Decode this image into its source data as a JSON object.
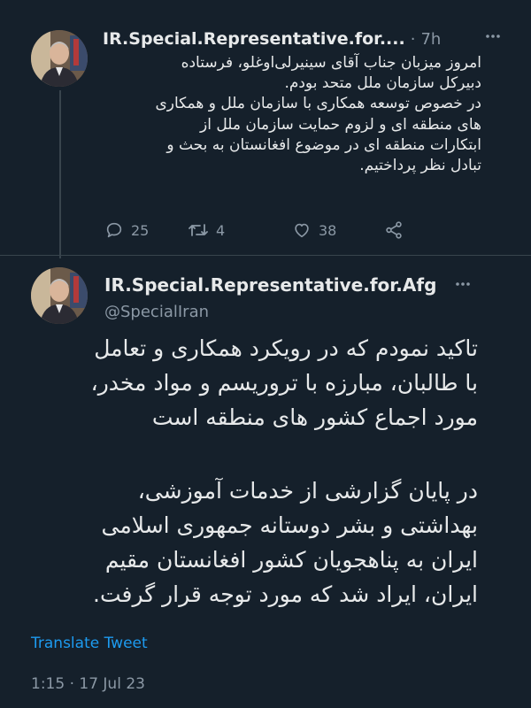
{
  "tweet1": {
    "display_name": "IR.Special.Representative.for....",
    "separator": "·",
    "time": "7h",
    "lines": [
      "امروز میزبان جناب آقای سینیرلی‌اوغلو، فرستاده",
      "دبیرکل سازمان ملل متحد بودم.",
      "در خصوص توسعه همکاری با سازمان ملل و همکاری",
      "های منطقه ای و لزوم حمایت سازمان ملل از",
      "ابتکارات منطقه ای در موضوع افغانستان به بحث و",
      "تبادل نظر پرداختیم."
    ],
    "actions": {
      "reply_count": "25",
      "retweet_count": "4",
      "like_count": "38"
    }
  },
  "tweet2": {
    "display_name": "IR.Special.Representative.for.Afg",
    "handle": "@SpecialIran",
    "paragraph1": [
      "تاکید نمودم که در رویکرد همکاری و تعامل",
      "با طالبان، مبارزه با تروریسم و مواد مخدر،",
      "مورد اجماع کشور های منطقه است"
    ],
    "paragraph2": [
      "در پایان گزارشی از خدمات آموزشی،",
      "بهداشتی و بشر دوستانه جمهوری اسلامی",
      "ایران به پناهجویان کشور افغانستان مقیم",
      "ایران، ایراد شد که مورد توجه قرار گرفت."
    ],
    "translate_label": "Translate Tweet",
    "datetime": "1:15 · 17 Jul 23"
  },
  "icons": {
    "reply": "reply-icon",
    "retweet": "retweet-icon",
    "like": "heart-icon",
    "share": "share-icon",
    "more": "more-options-icon"
  },
  "colors": {
    "background": "#15202b",
    "text": "#e7e9ea",
    "muted": "#8b98a5",
    "link": "#1d9bf0"
  }
}
